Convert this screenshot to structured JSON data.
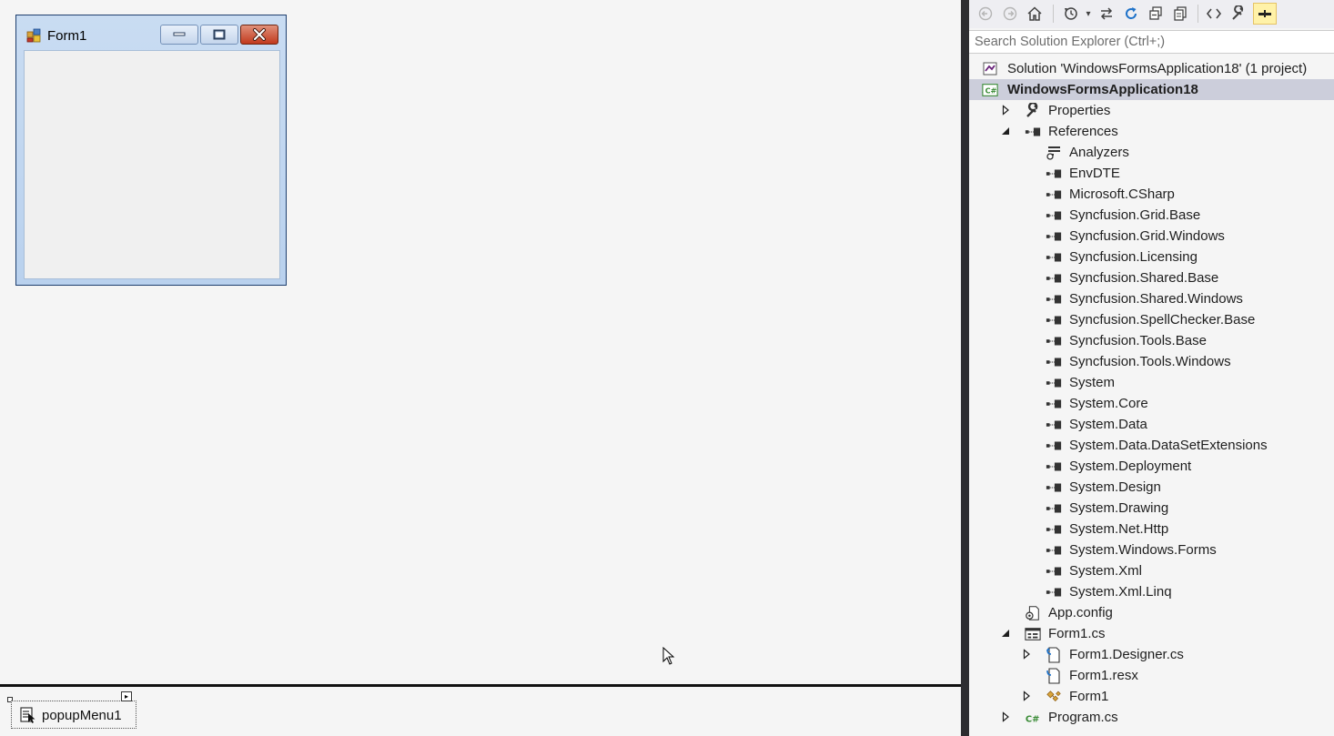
{
  "form": {
    "title": "Form1"
  },
  "tray": {
    "component_label": "popupMenu1"
  },
  "explorer": {
    "search_placeholder": "Search Solution Explorer (Ctrl+;)",
    "toolbar_icons": [
      "back-icon",
      "forward-icon",
      "home-icon",
      "history-icon",
      "sync-icon",
      "refresh-icon",
      "collapse-all-icon",
      "show-all-files-icon",
      "view-code-icon",
      "properties-icon",
      "pin-icon"
    ],
    "tree": [
      {
        "label": "Solution 'WindowsFormsApplication18' (1 project)",
        "icon": "solution-icon",
        "level": 0,
        "arrow": "none"
      },
      {
        "label": "WindowsFormsApplication18",
        "icon": "csharp-project-icon",
        "level": 0,
        "arrow": "expanded",
        "bold": true,
        "selected": true
      },
      {
        "label": "Properties",
        "icon": "wrench-icon",
        "level": 1,
        "arrow": "collapsed"
      },
      {
        "label": "References",
        "icon": "reference-icon",
        "level": 1,
        "arrow": "expanded"
      },
      {
        "label": "Analyzers",
        "icon": "analyzer-icon",
        "level": 2,
        "arrow": "none"
      },
      {
        "label": "EnvDTE",
        "icon": "reference-icon",
        "level": 2,
        "arrow": "none"
      },
      {
        "label": "Microsoft.CSharp",
        "icon": "reference-icon",
        "level": 2,
        "arrow": "none"
      },
      {
        "label": "Syncfusion.Grid.Base",
        "icon": "reference-icon",
        "level": 2,
        "arrow": "none"
      },
      {
        "label": "Syncfusion.Grid.Windows",
        "icon": "reference-icon",
        "level": 2,
        "arrow": "none"
      },
      {
        "label": "Syncfusion.Licensing",
        "icon": "reference-icon",
        "level": 2,
        "arrow": "none"
      },
      {
        "label": "Syncfusion.Shared.Base",
        "icon": "reference-icon",
        "level": 2,
        "arrow": "none"
      },
      {
        "label": "Syncfusion.Shared.Windows",
        "icon": "reference-icon",
        "level": 2,
        "arrow": "none"
      },
      {
        "label": "Syncfusion.SpellChecker.Base",
        "icon": "reference-icon",
        "level": 2,
        "arrow": "none"
      },
      {
        "label": "Syncfusion.Tools.Base",
        "icon": "reference-icon",
        "level": 2,
        "arrow": "none"
      },
      {
        "label": "Syncfusion.Tools.Windows",
        "icon": "reference-icon",
        "level": 2,
        "arrow": "none"
      },
      {
        "label": "System",
        "icon": "reference-icon",
        "level": 2,
        "arrow": "none"
      },
      {
        "label": "System.Core",
        "icon": "reference-icon",
        "level": 2,
        "arrow": "none"
      },
      {
        "label": "System.Data",
        "icon": "reference-icon",
        "level": 2,
        "arrow": "none"
      },
      {
        "label": "System.Data.DataSetExtensions",
        "icon": "reference-icon",
        "level": 2,
        "arrow": "none"
      },
      {
        "label": "System.Deployment",
        "icon": "reference-icon",
        "level": 2,
        "arrow": "none"
      },
      {
        "label": "System.Design",
        "icon": "reference-icon",
        "level": 2,
        "arrow": "none"
      },
      {
        "label": "System.Drawing",
        "icon": "reference-icon",
        "level": 2,
        "arrow": "none"
      },
      {
        "label": "System.Net.Http",
        "icon": "reference-icon",
        "level": 2,
        "arrow": "none"
      },
      {
        "label": "System.Windows.Forms",
        "icon": "reference-icon",
        "level": 2,
        "arrow": "none"
      },
      {
        "label": "System.Xml",
        "icon": "reference-icon",
        "level": 2,
        "arrow": "none"
      },
      {
        "label": "System.Xml.Linq",
        "icon": "reference-icon",
        "level": 2,
        "arrow": "none"
      },
      {
        "label": "App.config",
        "icon": "config-icon",
        "level": 1,
        "arrow": "none"
      },
      {
        "label": "Form1.cs",
        "icon": "form-icon",
        "level": 1,
        "arrow": "expanded"
      },
      {
        "label": "Form1.Designer.cs",
        "icon": "cs-file-icon",
        "level": 2,
        "arrow": "collapsed"
      },
      {
        "label": "Form1.resx",
        "icon": "resx-file-icon",
        "level": 2,
        "arrow": "none"
      },
      {
        "label": "Form1",
        "icon": "class-icon",
        "level": 2,
        "arrow": "collapsed"
      },
      {
        "label": "Program.cs",
        "icon": "csharp-file-icon",
        "level": 1,
        "arrow": "collapsed"
      }
    ]
  }
}
